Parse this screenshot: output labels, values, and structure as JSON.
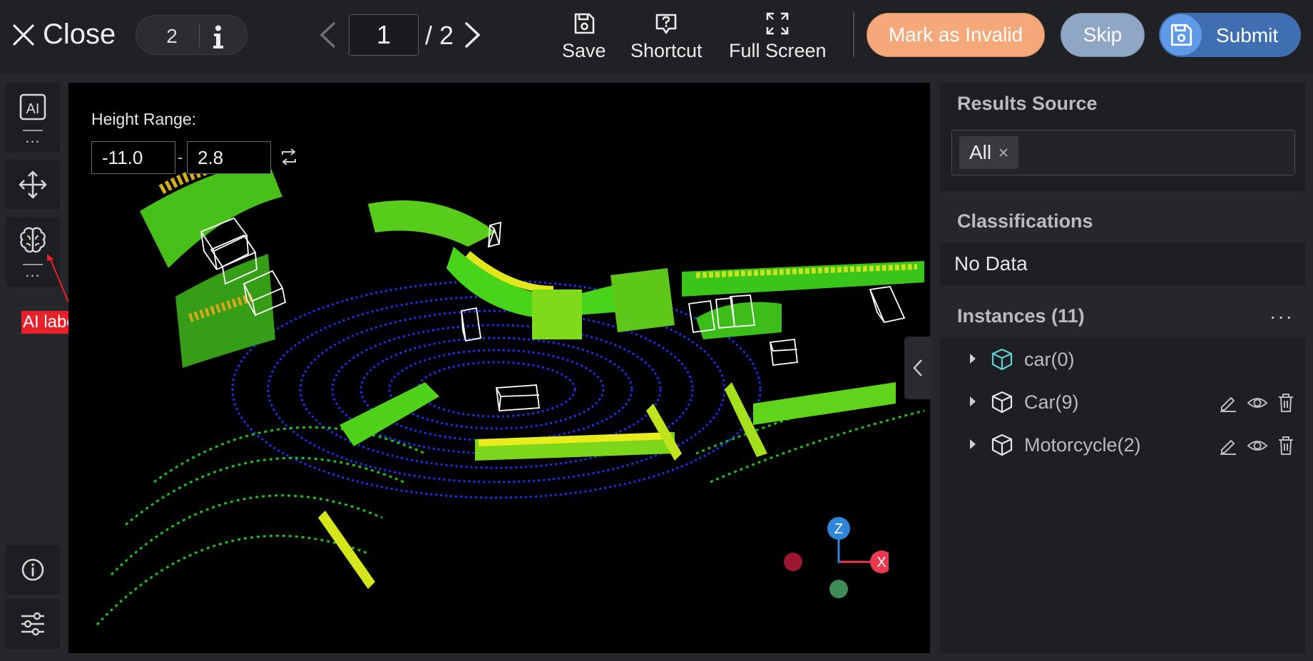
{
  "header": {
    "close_label": "Close",
    "task_count": "2",
    "page": {
      "current": "1",
      "total_label": "/ 2"
    },
    "tools": [
      {
        "label": "Save",
        "icon": "save-icon"
      },
      {
        "label": "Shortcut",
        "icon": "shortcut-icon"
      },
      {
        "label": "Full Screen",
        "icon": "fullscreen-icon"
      }
    ],
    "mark_invalid_label": "Mark as Invalid",
    "skip_label": "Skip",
    "submit_label": "Submit"
  },
  "left_toolbar": {
    "ai_icon_text": "AI",
    "ai_labeling_tooltip": "AI labeling",
    "more_label": "...",
    "tools": [
      "ai-tool-icon",
      "move-icon",
      "brain-icon",
      "info-icon",
      "sliders-icon"
    ]
  },
  "viewport": {
    "height_range_label": "Height Range:",
    "height_min": "-11.0",
    "height_max": "2.8",
    "range_separator": "-",
    "axes": {
      "z": "Z",
      "x": "X"
    }
  },
  "right_panel": {
    "results_source": {
      "title": "Results Source",
      "selected_tag": "All"
    },
    "classifications": {
      "title": "Classifications",
      "empty_text": "No Data"
    },
    "instances": {
      "title": "Instances (11)",
      "more_label": "···",
      "items": [
        {
          "label": "car(0)",
          "icon": "cube-outline-icon",
          "icon_color": "#5fd2d8",
          "actions": false
        },
        {
          "label": "Car(9)",
          "icon": "cube-outline-icon",
          "icon_color": "#e6e6e6",
          "actions": true
        },
        {
          "label": "Motorcycle(2)",
          "icon": "cube-outline-icon",
          "icon_color": "#e6e6e6",
          "actions": true
        }
      ]
    }
  },
  "colors": {
    "mark_invalid": "#f5a87a",
    "skip": "#8fa7c4",
    "submit": "#3f6fb0",
    "tooltip": "#e8202a",
    "axis_z": "#2f86d8",
    "axis_x": "#e83a4e"
  }
}
